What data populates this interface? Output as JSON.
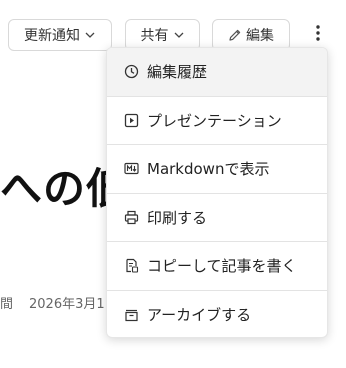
{
  "toolbar": {
    "notify_label": "更新通知",
    "share_label": "共有",
    "edit_label": "編集"
  },
  "article": {
    "title_fragment": "への低",
    "meta_left": "間",
    "date_fragment": "2026年3月1"
  },
  "menu": {
    "items": [
      {
        "label": "編集履歴",
        "icon": "clock-icon"
      },
      {
        "label": "プレゼンテーション",
        "icon": "play-icon"
      },
      {
        "label": "Markdownで表示",
        "icon": "markdown-icon"
      },
      {
        "label": "印刷する",
        "icon": "printer-icon"
      },
      {
        "label": "コピーして記事を書く",
        "icon": "copy-doc-icon"
      },
      {
        "label": "アーカイブする",
        "icon": "archive-icon"
      }
    ]
  }
}
